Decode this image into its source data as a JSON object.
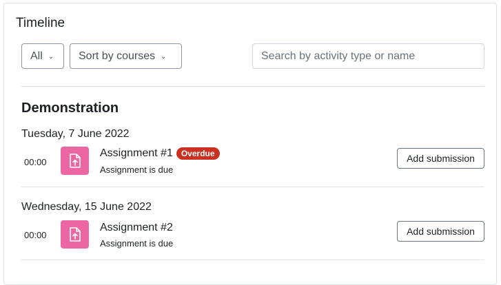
{
  "block": {
    "title": "Timeline",
    "filter_label": "All",
    "sort_label": "Sort by courses",
    "search_placeholder": "Search by activity type or name"
  },
  "course": {
    "name": "Demonstration",
    "days": [
      {
        "date": "Tuesday, 7 June 2022",
        "events": [
          {
            "time": "00:00",
            "icon": "assignment-icon",
            "name": "Assignment #1",
            "badge": "Overdue",
            "subtitle": "Assignment is due",
            "action": "Add submission"
          }
        ]
      },
      {
        "date": "Wednesday, 15 June 2022",
        "events": [
          {
            "time": "00:00",
            "icon": "assignment-icon",
            "name": "Assignment #2",
            "subtitle": "Assignment is due",
            "action": "Add submission"
          }
        ]
      }
    ]
  },
  "colors": {
    "activity_icon_bg": "#eb66a2",
    "overdue_badge": "#ca3120"
  }
}
